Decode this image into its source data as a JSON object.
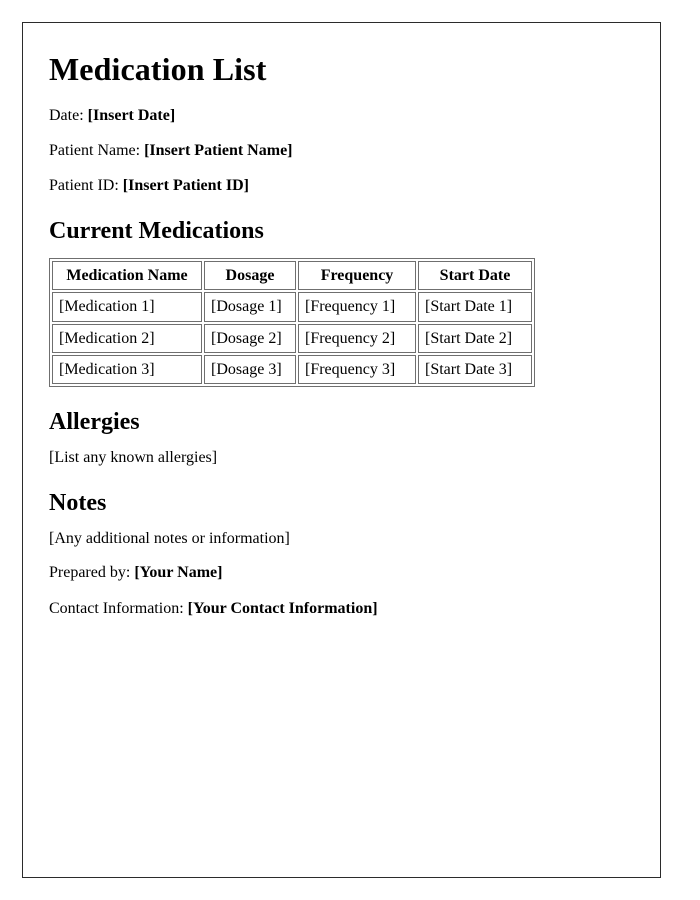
{
  "document": {
    "title": "Medication List",
    "frame_border_color": "#2b2b2b",
    "background_color": "#ffffff",
    "text_color": "#000000"
  },
  "header_fields": [
    {
      "label": "Date:",
      "value": "[Insert Date]"
    },
    {
      "label": "Patient Name:",
      "value": "[Insert Patient Name]"
    },
    {
      "label": "Patient ID:",
      "value": "[Insert Patient ID]"
    }
  ],
  "sections": {
    "current_medications": {
      "heading": "Current Medications",
      "table": {
        "columns": [
          "Medication Name",
          "Dosage",
          "Frequency",
          "Start Date"
        ],
        "rows": [
          [
            "[Medication 1]",
            "[Dosage 1]",
            "[Frequency 1]",
            "[Start Date 1]"
          ],
          [
            "[Medication 2]",
            "[Dosage 2]",
            "[Frequency 2]",
            "[Start Date 2]"
          ],
          [
            "[Medication 3]",
            "[Dosage 3]",
            "[Frequency 3]",
            "[Start Date 3]"
          ]
        ]
      }
    },
    "allergies": {
      "heading": "Allergies",
      "body": "[List any known allergies]"
    },
    "notes": {
      "heading": "Notes",
      "body": "[Any additional notes or information]"
    }
  },
  "footer_fields": [
    {
      "label": "Prepared by:",
      "value": "[Your Name]"
    },
    {
      "label": "Contact Information:",
      "value": "[Your Contact Information]"
    }
  ]
}
